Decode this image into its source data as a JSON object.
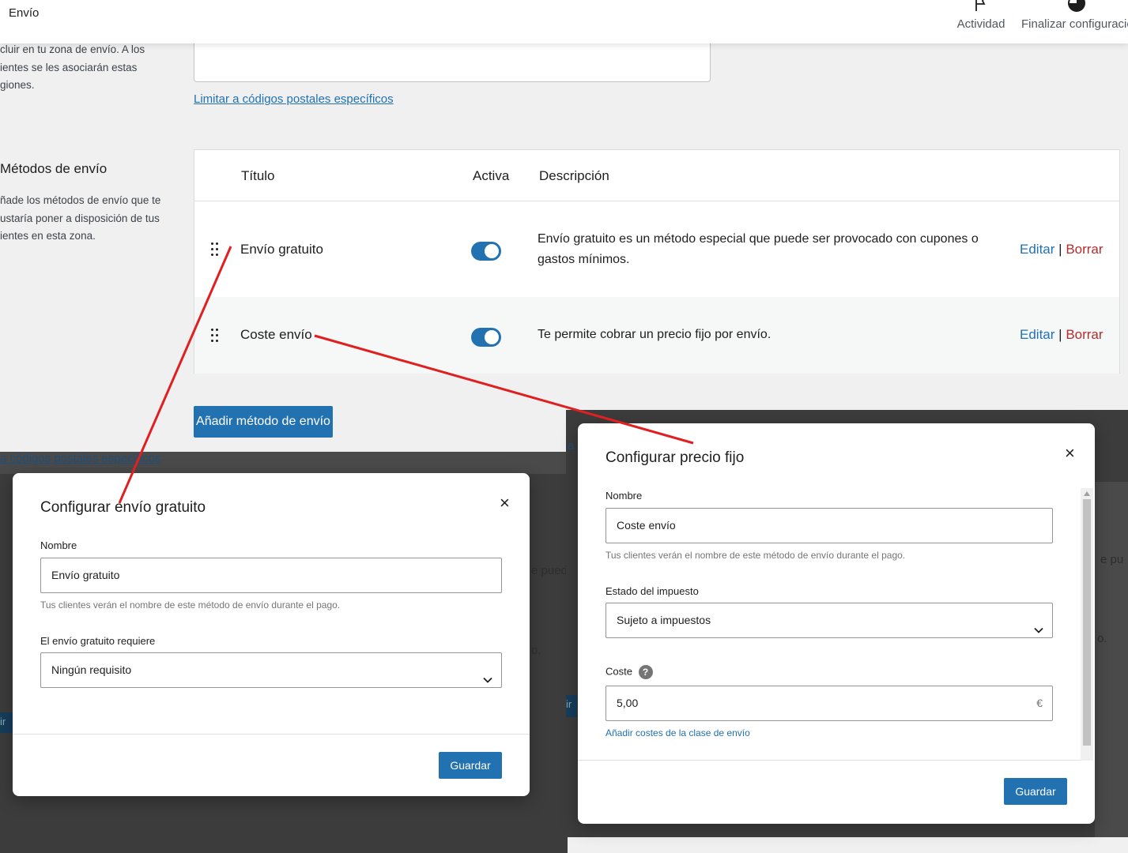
{
  "topbar": {
    "title": "Envío",
    "activity_label": "Actividad",
    "finish_label": "Finalizar configuració"
  },
  "regions": {
    "description": [
      "cluir en tu zona de envío. A los",
      "ientes se les asociarán estas",
      "giones."
    ],
    "postal_link": "Limitar a códigos postales específicos"
  },
  "methods_section": {
    "title": "Métodos de envío",
    "description": [
      "ñade los métodos de envío que te",
      "ustaría poner a disposición de tus",
      "ientes en esta zona."
    ]
  },
  "table": {
    "headers": {
      "title": "Título",
      "active": "Activa",
      "description": "Descripción"
    },
    "rows": [
      {
        "name": "Envío gratuito",
        "description_lines": [
          "Envío gratuito es un método especial que puede ser provocado con cupones o",
          "gastos mínimos."
        ],
        "active": true,
        "edit": "Editar",
        "separator": "|",
        "delete": "Borrar"
      },
      {
        "name": "Coste envío",
        "description_lines": [
          "Te permite cobrar un precio fijo por envío."
        ],
        "active": true,
        "edit": "Editar",
        "separator": "|",
        "delete": "Borrar"
      }
    ]
  },
  "add_method_button": "Añadir método de envío",
  "background_fragments": {
    "left_link": "a códigos postales específicos",
    "left_text": "e pued",
    "left_text2": "o.",
    "left_btn": "ir",
    "right_text": "e pu",
    "right_text2": "o.",
    "right_btn": "ir",
    "right_link": "a"
  },
  "free_modal": {
    "title": "Configurar envío gratuito",
    "close": "×",
    "name_label": "Nombre",
    "name_value": "Envío gratuito",
    "name_help": "Tus clientes verán el nombre de este método de envío durante el pago.",
    "requires_label": "El envío gratuito requiere",
    "requires_value": "Ningún requisito",
    "save": "Guardar"
  },
  "flat_modal": {
    "title": "Configurar precio fijo",
    "close": "×",
    "name_label": "Nombre",
    "name_value": "Coste envío",
    "name_help": "Tus clientes verán el nombre de este método de envío durante el pago.",
    "tax_label": "Estado del impuesto",
    "tax_value": "Sujeto a impuestos",
    "cost_label": "Coste",
    "cost_help_icon": "?",
    "cost_value": "5,00",
    "currency": "€",
    "class_link": "Añadir costes de la clase de envío",
    "save": "Guardar"
  },
  "annotation_color": "#e02020"
}
